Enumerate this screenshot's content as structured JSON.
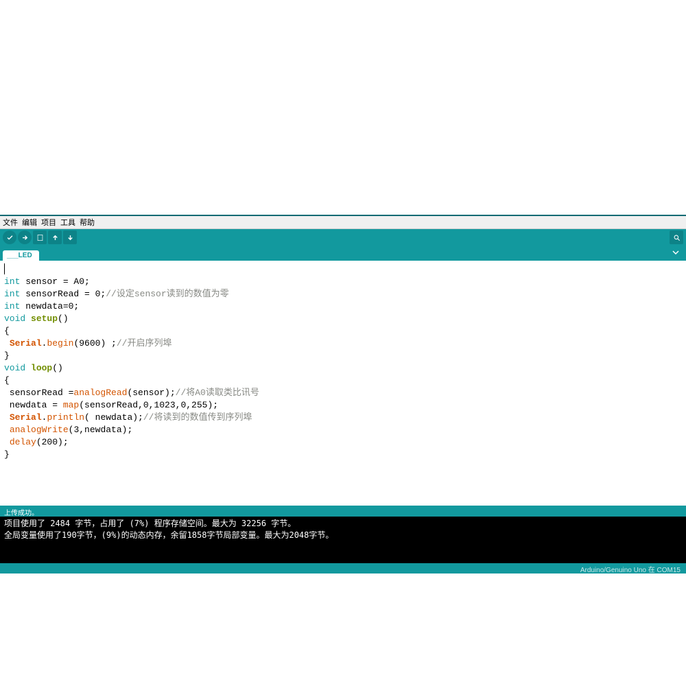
{
  "menu": {
    "file": "文件",
    "edit": "编辑",
    "sketch": "项目",
    "tools": "工具",
    "help": "帮助"
  },
  "toolbar": {
    "verify_title": "Verify",
    "upload_title": "Upload",
    "new_title": "New",
    "open_title": "Open",
    "save_title": "Save",
    "serial_title": "Serial Monitor"
  },
  "tab": {
    "name": "___LED"
  },
  "code": {
    "l1_a": "int",
    "l1_b": " sensor = A0;",
    "l2_a": "int",
    "l2_b": " sensorRead = 0;",
    "l2_c": "//设定sensor读到的数值为零",
    "l3_a": "int",
    "l3_b": " newdata=0;",
    "l4_a": "void",
    "l4_b": " ",
    "l4_c": "setup",
    "l4_d": "()",
    "l5": "{",
    "l6_a": " ",
    "l6_b": "Serial",
    "l6_c": ".",
    "l6_d": "begin",
    "l6_e": "(9600) ;",
    "l6_f": "//开启序列埠",
    "l7": "}",
    "l8_a": "void",
    "l8_b": " ",
    "l8_c": "loop",
    "l8_d": "()",
    "l9": "{",
    "l10_a": " sensorRead =",
    "l10_b": "analogRead",
    "l10_c": "(sensor);",
    "l10_d": "//将A0读取类比讯号",
    "l11_a": " newdata = ",
    "l11_b": "map",
    "l11_c": "(sensorRead,0,1023,0,255);",
    "l12_a": " ",
    "l12_b": "Serial",
    "l12_c": ".",
    "l12_d": "println",
    "l12_e": "( newdata);",
    "l12_f": "//将读到的数值传到序列埠",
    "l13_a": " ",
    "l13_b": "analogWrite",
    "l13_c": "(3,newdata);",
    "l14_a": " ",
    "l14_b": "delay",
    "l14_c": "(200);",
    "l15": "}"
  },
  "status": {
    "text": "上传成功。"
  },
  "console": {
    "line1": "项目使用了 2484 字节，占用了 (7%) 程序存储空间。最大为 32256 字节。",
    "line2": "全局变量使用了190字节，(9%)的动态内存，余留1858字节局部变量。最大为2048字节。"
  },
  "footer": {
    "board": "Arduino/Genuino Uno 在 COM15"
  }
}
